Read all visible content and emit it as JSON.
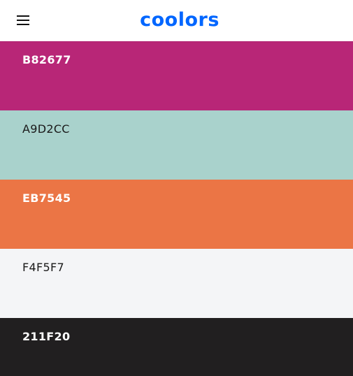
{
  "header": {
    "brand": "coolors",
    "brand_color": "#0066ff",
    "menu_icon": "hamburger-menu-icon"
  },
  "palette": {
    "colors": [
      {
        "hex": "B82677",
        "value": "#B82677",
        "text_color": "#ffffff"
      },
      {
        "hex": "A9D2CC",
        "value": "#A9D2CC",
        "text_color": "#1a1a1a"
      },
      {
        "hex": "EB7545",
        "value": "#EB7545",
        "text_color": "#ffffff"
      },
      {
        "hex": "F4F5F7",
        "value": "#F4F5F7",
        "text_color": "#1a1a1a"
      },
      {
        "hex": "211F20",
        "value": "#211F20",
        "text_color": "#ffffff"
      }
    ]
  }
}
